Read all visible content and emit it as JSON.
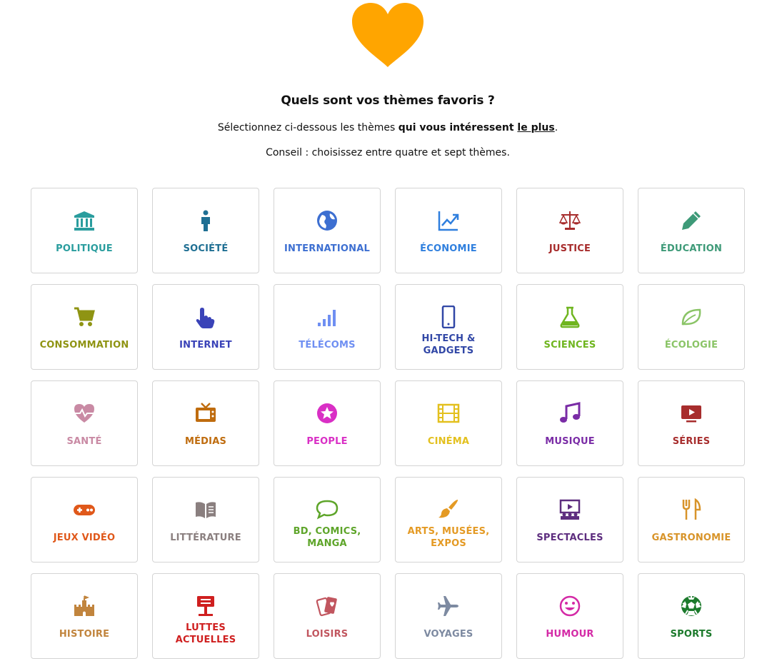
{
  "header": {
    "title": "Quels sont vos thèmes favoris ?",
    "subtitle_pre": "Sélectionnez ci-dessous les thèmes ",
    "subtitle_bold": "qui vous intéressent ",
    "subtitle_under": "le plus",
    "subtitle_post": ".",
    "tip": "Conseil : choisissez entre quatre et sept thèmes.",
    "heart_color": "#FFA500"
  },
  "themes": [
    {
      "key": "politique",
      "label": "POLITIQUE",
      "color": "#2a9d9e",
      "icon": "bank-icon"
    },
    {
      "key": "societe",
      "label": "SOCIÉTÉ",
      "color": "#1f6f93",
      "icon": "person-icon"
    },
    {
      "key": "international",
      "label": "INTERNATIONAL",
      "color": "#3d6fd1",
      "icon": "globe-icon"
    },
    {
      "key": "economie",
      "label": "ÉCONOMIE",
      "color": "#2f7fde",
      "icon": "trending-up-icon"
    },
    {
      "key": "justice",
      "label": "JUSTICE",
      "color": "#a72c2c",
      "icon": "scales-icon"
    },
    {
      "key": "education",
      "label": "ÉDUCATION",
      "color": "#3e9a78",
      "icon": "pencil-icon"
    },
    {
      "key": "consommation",
      "label": "CONSOMMATION",
      "color": "#8f9413",
      "icon": "cart-icon"
    },
    {
      "key": "internet",
      "label": "INTERNET",
      "color": "#3a43b8",
      "icon": "pointer-hand-icon"
    },
    {
      "key": "telecoms",
      "label": "TÉLÉCOMS",
      "color": "#6f8ff2",
      "icon": "signal-bars-icon"
    },
    {
      "key": "hitech",
      "label": "HI-TECH & GADGETS",
      "color": "#3147a6",
      "icon": "smartphone-icon"
    },
    {
      "key": "sciences",
      "label": "SCIENCES",
      "color": "#6fb51f",
      "icon": "flask-icon"
    },
    {
      "key": "ecologie",
      "label": "ÉCOLOGIE",
      "color": "#8ac466",
      "icon": "leaf-icon"
    },
    {
      "key": "sante",
      "label": "SANTÉ",
      "color": "#c98aa4",
      "icon": "heartbeat-icon"
    },
    {
      "key": "medias",
      "label": "MÉDIAS",
      "color": "#bf6c0e",
      "icon": "tv-icon"
    },
    {
      "key": "people",
      "label": "PEOPLE",
      "color": "#d92fc5",
      "icon": "star-circle-icon"
    },
    {
      "key": "cinema",
      "label": "CINÉMA",
      "color": "#e3c01e",
      "icon": "film-icon"
    },
    {
      "key": "musique",
      "label": "MUSIQUE",
      "color": "#7a2ca6",
      "icon": "music-note-icon"
    },
    {
      "key": "series",
      "label": "SÉRIES",
      "color": "#a72d2d",
      "icon": "play-screen-icon"
    },
    {
      "key": "jeuxvideo",
      "label": "JEUX VIDÉO",
      "color": "#e0581a",
      "icon": "gamepad-icon"
    },
    {
      "key": "litterature",
      "label": "LITTÉRATURE",
      "color": "#8a7f7f",
      "icon": "book-icon"
    },
    {
      "key": "bd",
      "label": "BD, COMICS, MANGA",
      "color": "#5ea52a",
      "icon": "speech-bubble-icon"
    },
    {
      "key": "arts",
      "label": "ARTS, MUSÉES, EXPOS",
      "color": "#e49a24",
      "icon": "paintbrush-icon"
    },
    {
      "key": "spectacles",
      "label": "SPECTACLES",
      "color": "#5e2e7f",
      "icon": "stage-icon"
    },
    {
      "key": "gastronomie",
      "label": "GASTRONOMIE",
      "color": "#d8942a",
      "icon": "cutlery-icon"
    },
    {
      "key": "histoire",
      "label": "HISTOIRE",
      "color": "#c1843d",
      "icon": "castle-icon"
    },
    {
      "key": "luttes",
      "label": "LUTTES ACTUELLES",
      "color": "#cf1f1f",
      "icon": "protest-sign-icon"
    },
    {
      "key": "loisirs",
      "label": "LOISIRS",
      "color": "#c1565f",
      "icon": "cards-icon"
    },
    {
      "key": "voyages",
      "label": "VOYAGES",
      "color": "#7d8aa1",
      "icon": "airplane-icon"
    },
    {
      "key": "humour",
      "label": "HUMOUR",
      "color": "#d42aa6",
      "icon": "smiley-icon"
    },
    {
      "key": "sports",
      "label": "SPORTS",
      "color": "#1c7a2c",
      "icon": "soccer-ball-icon"
    }
  ]
}
